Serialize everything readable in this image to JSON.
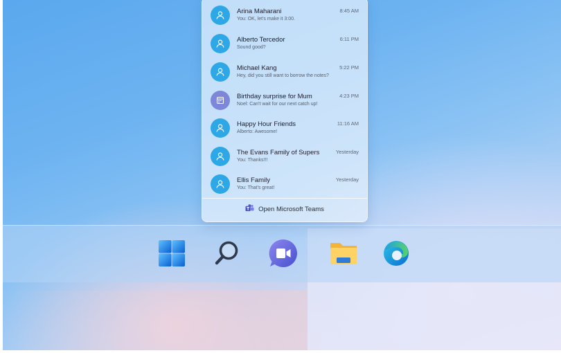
{
  "chats": [
    {
      "name": "Arina Maharani",
      "preview": "You: OK, let's make it 3:00.",
      "time": "8:45 AM",
      "avatar": "person-icon",
      "avatar_color": "#2ea7e6"
    },
    {
      "name": "Alberto Tercedor",
      "preview": "Sound good?",
      "time": "6:11 PM",
      "avatar": "person-icon",
      "avatar_color": "#2ea7e6"
    },
    {
      "name": "Michael Kang",
      "preview": "Hey, did you still want to borrow the notes?",
      "time": "5:22 PM",
      "avatar": "person-icon",
      "avatar_color": "#2ea7e6"
    },
    {
      "name": "Birthday surprise for Mum",
      "preview": "Noel: Can't wait for our next catch up!",
      "time": "4:23 PM",
      "avatar": "calendar-icon",
      "avatar_color": "#7d86d8"
    },
    {
      "name": "Happy Hour Friends",
      "preview": "Alberto: Awesome!",
      "time": "11:16 AM",
      "avatar": "person-icon",
      "avatar_color": "#2ea7e6"
    },
    {
      "name": "The Evans Family of Supers",
      "preview": "You: Thanks!!!",
      "time": "Yesterday",
      "avatar": "person-icon",
      "avatar_color": "#2ea7e6"
    },
    {
      "name": "Ellis Family",
      "preview": "You: That's great!",
      "time": "Yesterday",
      "avatar": "person-icon",
      "avatar_color": "#2ea7e6"
    }
  ],
  "footer": {
    "open_teams_label": "Open Microsoft Teams",
    "icon": "teams-icon"
  },
  "taskbar": {
    "icons": [
      "windows-start-icon",
      "search-icon",
      "chat-icon",
      "file-explorer-icon",
      "edge-browser-icon"
    ]
  },
  "colors": {
    "accent": "#2ea7e6",
    "group_avatar": "#7d86d8",
    "chat_button": "#5661d6"
  }
}
